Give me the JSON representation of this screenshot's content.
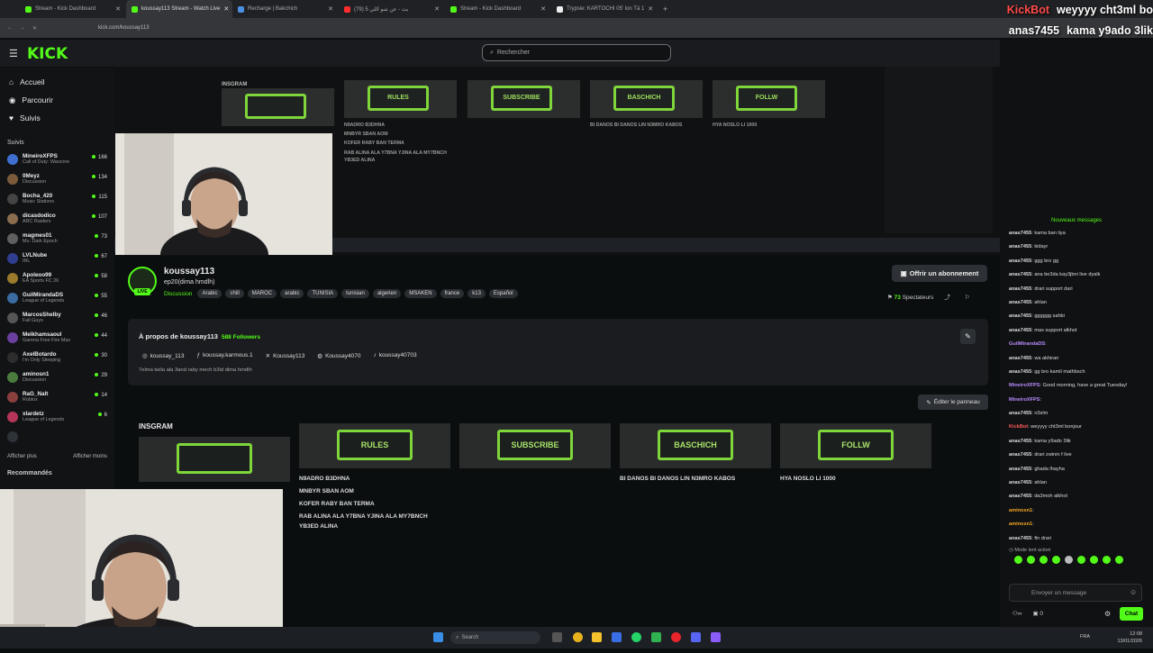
{
  "browser": {
    "tabs": [
      {
        "label": "Stream - Kick Dashboard",
        "color": "#53fc18"
      },
      {
        "label": "koussay113 Stream - Watch Live",
        "color": "#53fc18"
      },
      {
        "label": "Recharge | Bakchich",
        "color": "#4a90e2"
      },
      {
        "label": "بث - عن شو اللي 5 (79)",
        "color": "#ff2d2d"
      },
      {
        "label": "Stream - Kick Dashboard",
        "color": "#53fc18"
      },
      {
        "label": "Trypsie: KARTOCHI 05' lon Tä 1",
        "color": "#eeeeee"
      }
    ],
    "url": "kick.com/koussay113"
  },
  "header": {
    "logo": "KICK",
    "search_placeholder": "Rechercher"
  },
  "sidebar": {
    "nav": [
      {
        "icon": "home-icon",
        "glyph": "⌂",
        "label": "Accueil"
      },
      {
        "icon": "compass-icon",
        "glyph": "◉",
        "label": "Parcourir"
      },
      {
        "icon": "heart-icon",
        "glyph": "♥",
        "label": "Suivis"
      }
    ],
    "following_title": "Suivis",
    "following": [
      {
        "name": "MineiroXFPS",
        "category": "Call of Duty: Warzone",
        "viewers": "166"
      },
      {
        "name": "0Meyz",
        "category": "Discussion",
        "viewers": "134"
      },
      {
        "name": "Bocha_420",
        "category": "Music Stations",
        "viewers": "115"
      },
      {
        "name": "dicasdodico",
        "category": "ARC Raiders",
        "viewers": "107"
      },
      {
        "name": "magmes01",
        "category": "Mu: Dark Epoch",
        "viewers": "73"
      },
      {
        "name": "LVLNube",
        "category": "IRL",
        "viewers": "67"
      },
      {
        "name": "Apoleoo99",
        "category": "EA Sports FC 26",
        "viewers": "58"
      },
      {
        "name": "GuilMirandaDS",
        "category": "League of Legends",
        "viewers": "55"
      },
      {
        "name": "MarcosShelby",
        "category": "Fall Guys",
        "viewers": "46"
      },
      {
        "name": "Melkhamsaoul",
        "category": "Garena Free Fire Max",
        "viewers": "44"
      },
      {
        "name": "AxelBotardo",
        "category": "I'm Only Sleeping",
        "viewers": "30"
      },
      {
        "name": "aminosn1",
        "category": "Discussion",
        "viewers": "29"
      },
      {
        "name": "RaG_Nalt",
        "category": "Roblox",
        "viewers": "14"
      },
      {
        "name": "xlardetz",
        "category": "League of Legends",
        "viewers": "6"
      }
    ],
    "show_more": "Afficher plus",
    "show_less": "Afficher moins",
    "recommended_title": "Recommandés"
  },
  "video": {
    "boards": [
      "",
      "RULES",
      "SUBSCRIBE",
      "BASCHICH",
      "FOLLW"
    ],
    "label": "INSGRAM",
    "texts": [
      "N9ADRO B3DHNA",
      "MNBYR SBAN AOM",
      "KOFER RABY BAN TERMA",
      "RAB ALINA ALA Y7BNA YJINA ALA MY7BNCH YB3ED ALINA",
      "BI DANOS BI DANOS LIN N3MRO KABOS",
      "HYA NOSLO LI 1000"
    ]
  },
  "overlay_chat": [
    {
      "user": "KickBot",
      "msg": "weyyyy cht3ml bo",
      "color": "#ff4a4a"
    },
    {
      "user": "anas7455",
      "msg": "kama y9ado 3lik",
      "color": "#ffffff"
    },
    {
      "user": "anas7455",
      "msg": "drari zwinin f'live",
      "color": "#ffffff"
    },
    {
      "user": "anas7455",
      "msg": "ghada lhayha",
      "color": "#ffffff"
    },
    {
      "user": "anas7455",
      "msg": "ahlan",
      "color": "#ffffff"
    },
    {
      "user": "anas7455",
      "msg": "da3moh alkhot",
      "color": "#ffffff"
    },
    {
      "user": "aminosn1",
      "msg": "",
      "color": "#f5a623"
    },
    {
      "user": "aminosn1",
      "msg": "",
      "color": "#f5a623"
    },
    {
      "user": "anas7455",
      "msg": "fin drari",
      "color": "#ffffff"
    }
  ],
  "channel": {
    "name": "koussay113",
    "title": "ep20(dima hmdlh)",
    "live_badge": "LIVE",
    "category": "Discussion",
    "tags": [
      "Arabic",
      "chill",
      "MAROC",
      "arabic",
      "TUNISIA",
      "tunisian",
      "algerien",
      "MSAKEN",
      "france",
      "k13",
      "Español"
    ],
    "subscribe_label": "Offrir un abonnement",
    "viewers": "73",
    "viewers_label": "Spectateurs"
  },
  "about": {
    "title": "À propos de koussay113",
    "followers": "588 Followers",
    "socials": [
      {
        "icon": "instagram-icon",
        "glyph": "◎",
        "label": "koussay_113"
      },
      {
        "icon": "facebook-icon",
        "glyph": "ƒ",
        "label": "koussay.karmous.1"
      },
      {
        "icon": "x-icon",
        "glyph": "✕",
        "label": "Koussay113"
      },
      {
        "icon": "discord-icon",
        "glyph": "◍",
        "label": "Koussay4070"
      },
      {
        "icon": "tiktok-icon",
        "glyph": "♪",
        "label": "koussay40703"
      }
    ],
    "bio": "7elma twila ala 3and raby mech b3id dima hmdlh",
    "edit_panel": "Éditer le panneau"
  },
  "panels": {
    "heading": "INSGRAM",
    "boards": [
      "",
      "RULES",
      "SUBSCRIBE",
      "BASCHICH",
      "FOLLW"
    ],
    "rules_lines": [
      "N9ADRO B3DHNA",
      "MNBYR SBAN AOM",
      "KOFER RABY BAN TERMA",
      "RAB ALINA ALA Y7BNA YJINA ALA MY7BNCH",
      "YB3ED ALINA"
    ],
    "baschich_text": "BI DANOS BI DANOS LIN N3MRO KABOS",
    "follow_text": "HYA NOSLO LI 1000"
  },
  "chat": {
    "messages": [
      {
        "user": "anas7455",
        "msg": "kama ban liya"
      },
      {
        "user": "anas7455",
        "msg": "kidayr"
      },
      {
        "user": "anas7455",
        "msg": "ggg bro gg"
      },
      {
        "user": "anas7455",
        "msg": "ana be3da kay3jbni live dyalk"
      },
      {
        "user": "anas7455",
        "msg": "drari support dari"
      },
      {
        "user": "anas7455",
        "msg": "ahlan"
      },
      {
        "user": "anas7455",
        "msg": "gggggg sahbi"
      },
      {
        "user": "anas7455",
        "msg": "max support alkhot"
      },
      {
        "user": "GuilMirandaDS",
        "msg": ""
      },
      {
        "user": "anas7455",
        "msg": "wa akhiran"
      },
      {
        "user": "anas7455",
        "msg": "gg bro kamil mathbsch"
      },
      {
        "user": "MineiroXFPS",
        "msg": "Good morning, have a great Tuesday!"
      },
      {
        "user": "MineiroXFPS",
        "msg": ""
      },
      {
        "user": "anas7455",
        "msg": "n3slm"
      },
      {
        "user": "KickBot",
        "msg": "weyyyy cht3ml bonjour"
      },
      {
        "user": "anas7455",
        "msg": "kama y9ado 3lik"
      },
      {
        "user": "anas7455",
        "msg": "drari zwinin f live"
      },
      {
        "user": "anas7455",
        "msg": "ghada lhayha"
      },
      {
        "user": "anas7455",
        "msg": "ahlan"
      },
      {
        "user": "anas7455",
        "msg": "da3moh alkhot"
      },
      {
        "user": "aminosn1",
        "msg": ""
      },
      {
        "user": "aminosn1",
        "msg": ""
      },
      {
        "user": "anas7455",
        "msg": "fin drari"
      }
    ],
    "new_messages": "Nouveaux messages",
    "slow_mode": "Mode lent activé",
    "input_placeholder": "Envoyer un message",
    "points": "0",
    "chat_button": "Chat"
  },
  "taskbar": {
    "search": "Search",
    "time": "12:08",
    "date": "13/01/2026",
    "lang": "FRA"
  }
}
